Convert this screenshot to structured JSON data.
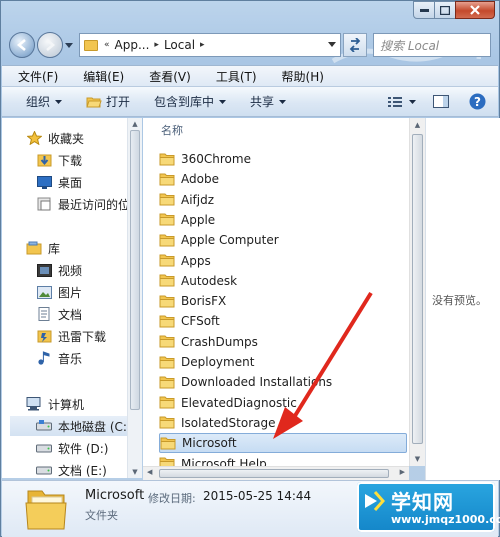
{
  "address": {
    "prefix": "«",
    "crumbs": [
      "App...",
      "Local"
    ]
  },
  "search": {
    "placeholder": "搜索 Local"
  },
  "menu": [
    "文件(F)",
    "编辑(E)",
    "查看(V)",
    "工具(T)",
    "帮助(H)"
  ],
  "toolbar": {
    "organize": "组织",
    "open": "打开",
    "include": "包含到库中",
    "share": "共享"
  },
  "nav": {
    "favorites": "收藏夹",
    "download": "下载",
    "desktop": "桌面",
    "recent": "最近访问的位",
    "library": "库",
    "video": "视频",
    "pictures": "图片",
    "documents": "文档",
    "thunder": "迅雷下载",
    "music": "音乐",
    "computer": "计算机",
    "local_c": "本地磁盘 (C:)",
    "soft_d": "软件 (D:)",
    "doc_e": "文档 (E:)"
  },
  "file_list": {
    "column_name": "名称",
    "items": [
      "360Chrome",
      "Adobe",
      "Aifjdz",
      "Apple",
      "Apple Computer",
      "Apps",
      "Autodesk",
      "BorisFX",
      "CFSoft",
      "CrashDumps",
      "Deployment",
      "Downloaded Installations",
      "ElevatedDiagnostic",
      "IsolatedStorage",
      "Microsoft",
      "Microsoft Help"
    ],
    "selected": "Microsoft"
  },
  "preview": {
    "text": "没有预览。"
  },
  "details": {
    "name": "Microsoft",
    "date_label": "修改日期:",
    "date_value": "2015-05-25 14:44",
    "type": "文件夹"
  },
  "logo": {
    "title": "学知网",
    "url": "www.jmqz1000.com"
  },
  "colors": {
    "folder": "#f2c54f",
    "selection": "#c6dcf3",
    "arrow": "#e0281d",
    "logo": "#1c95d6"
  }
}
